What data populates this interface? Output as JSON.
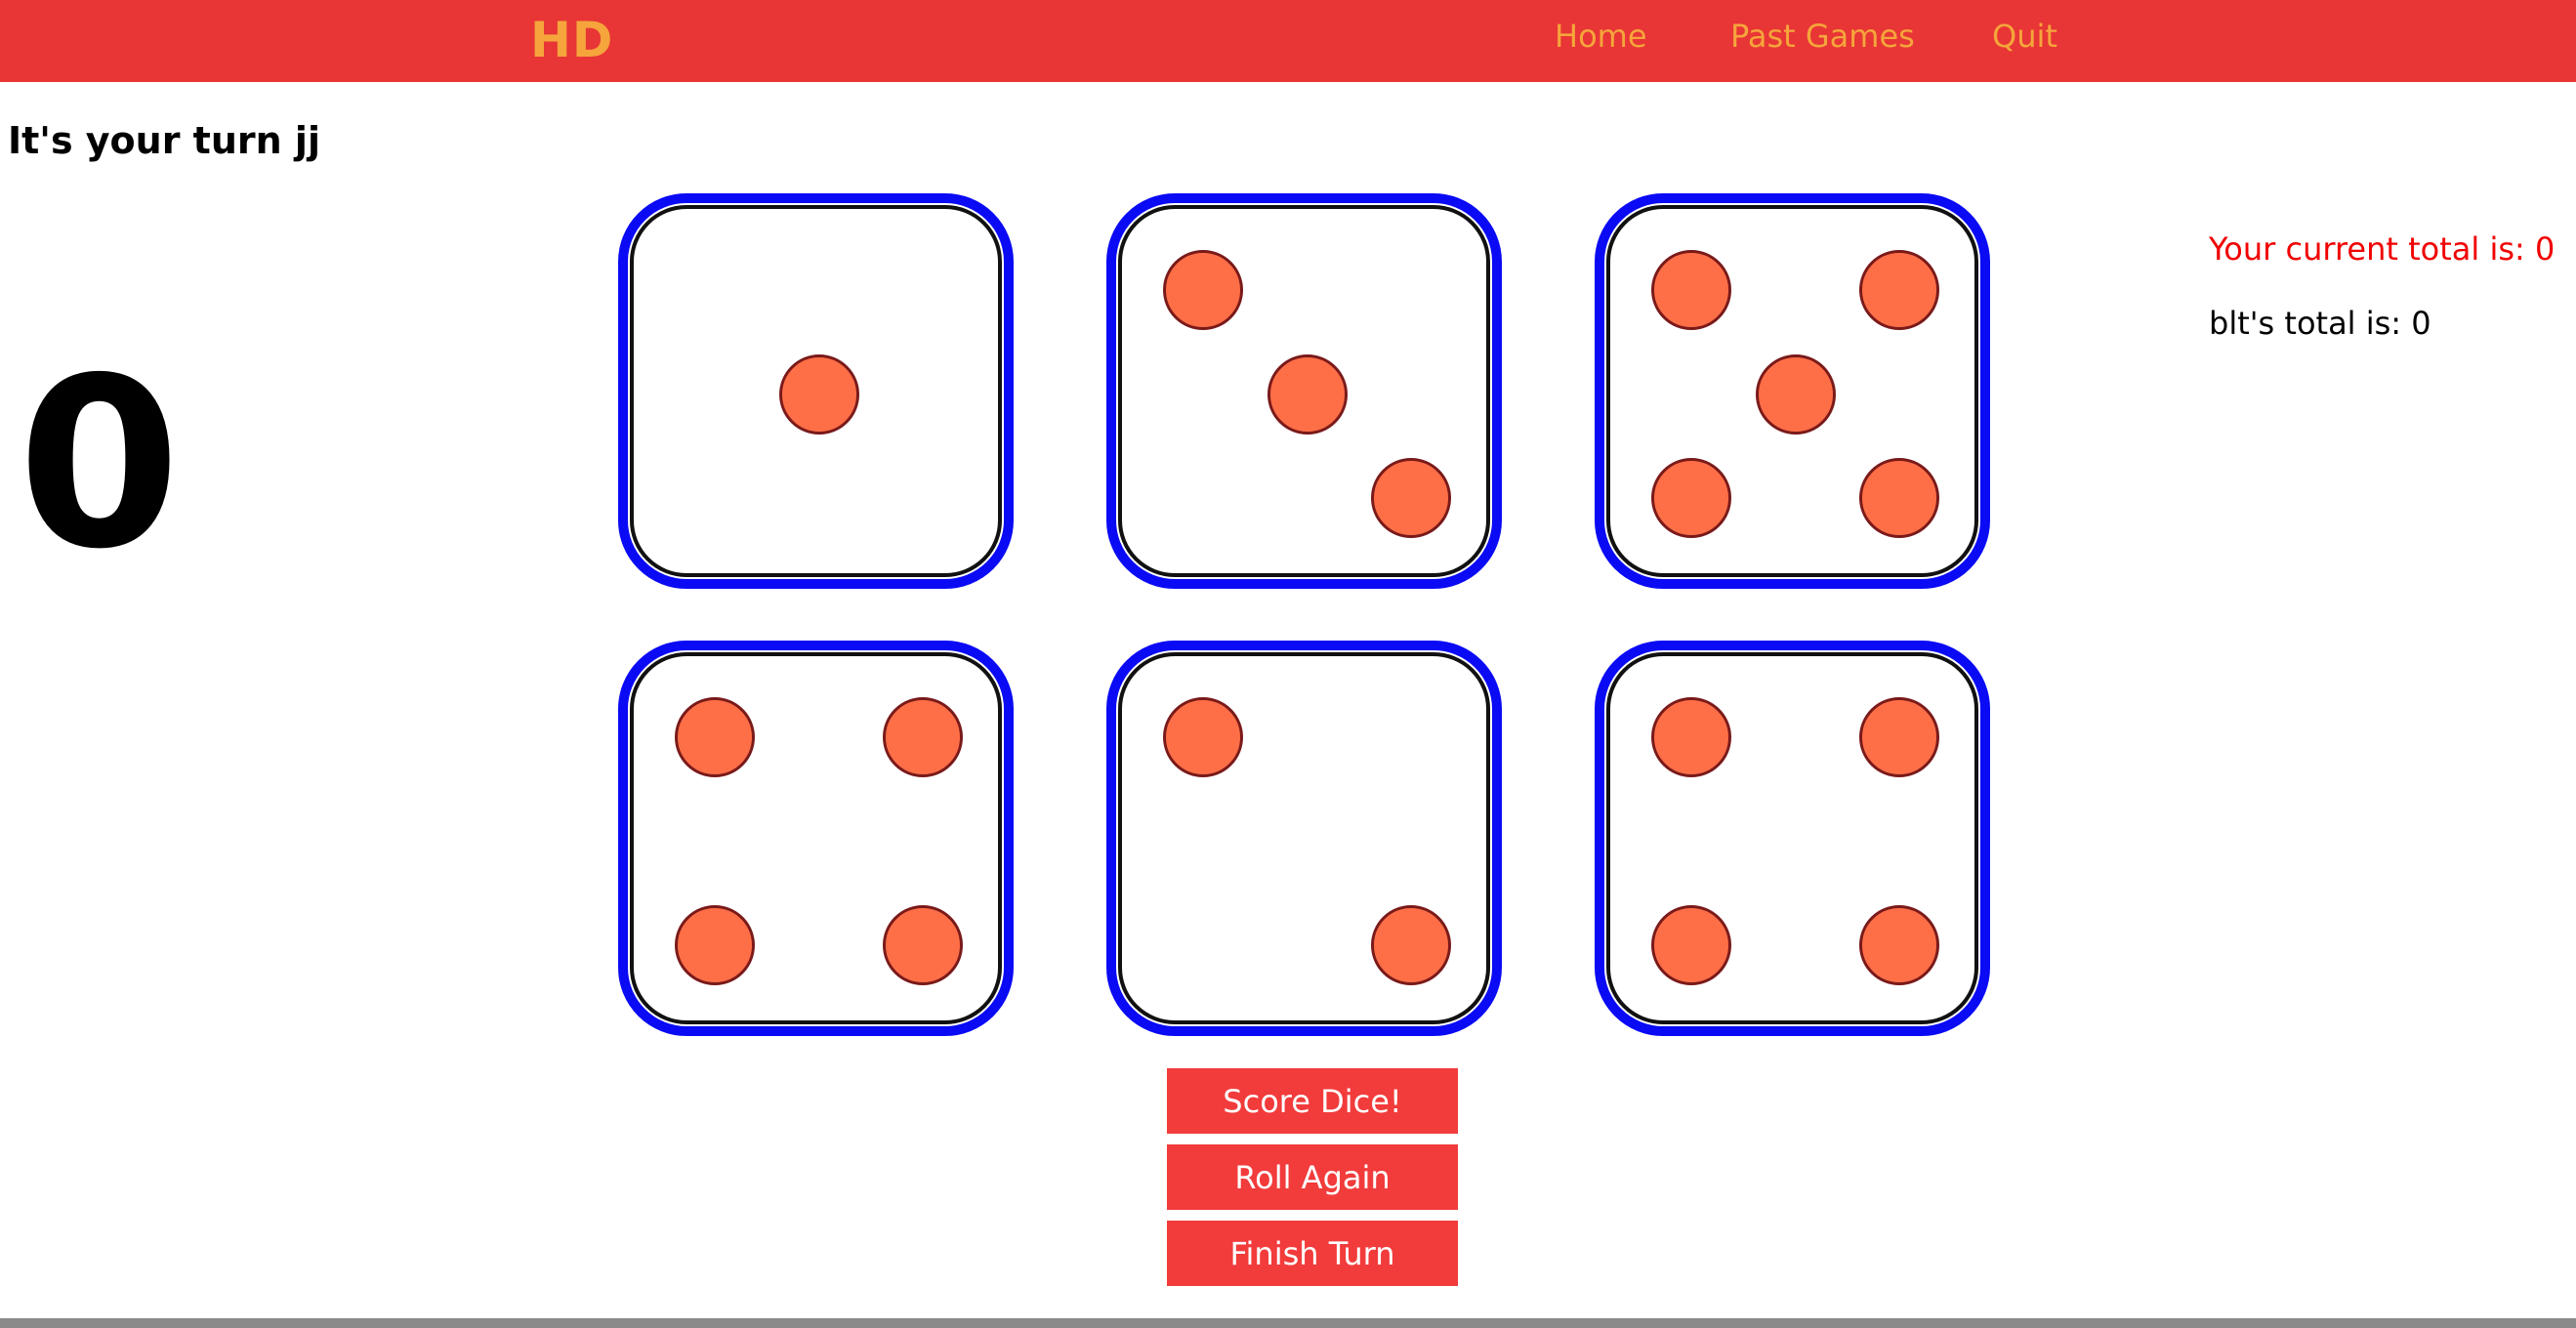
{
  "header": {
    "brand": "HD",
    "nav": [
      {
        "label": "Home"
      },
      {
        "label": "Past Games"
      },
      {
        "label": "Quit"
      }
    ]
  },
  "turn": {
    "message": "It's your turn jj",
    "turn_score": "0"
  },
  "dice": [
    {
      "value": 1
    },
    {
      "value": 3
    },
    {
      "value": 5
    },
    {
      "value": 4
    },
    {
      "value": 2
    },
    {
      "value": 4
    }
  ],
  "totals": {
    "player_line": "Your current total is: 0",
    "opponent_line": "blt's total is: 0"
  },
  "actions": {
    "score": "Score Dice!",
    "roll": "Roll Again",
    "finish": "Finish Turn"
  },
  "colors": {
    "header_bg": "#e83535",
    "accent": "#f5a53b",
    "die_border": "#0a0af5",
    "pip": "#ff6f47",
    "button_bg": "#f23b3b",
    "player_total": "#f00000"
  }
}
